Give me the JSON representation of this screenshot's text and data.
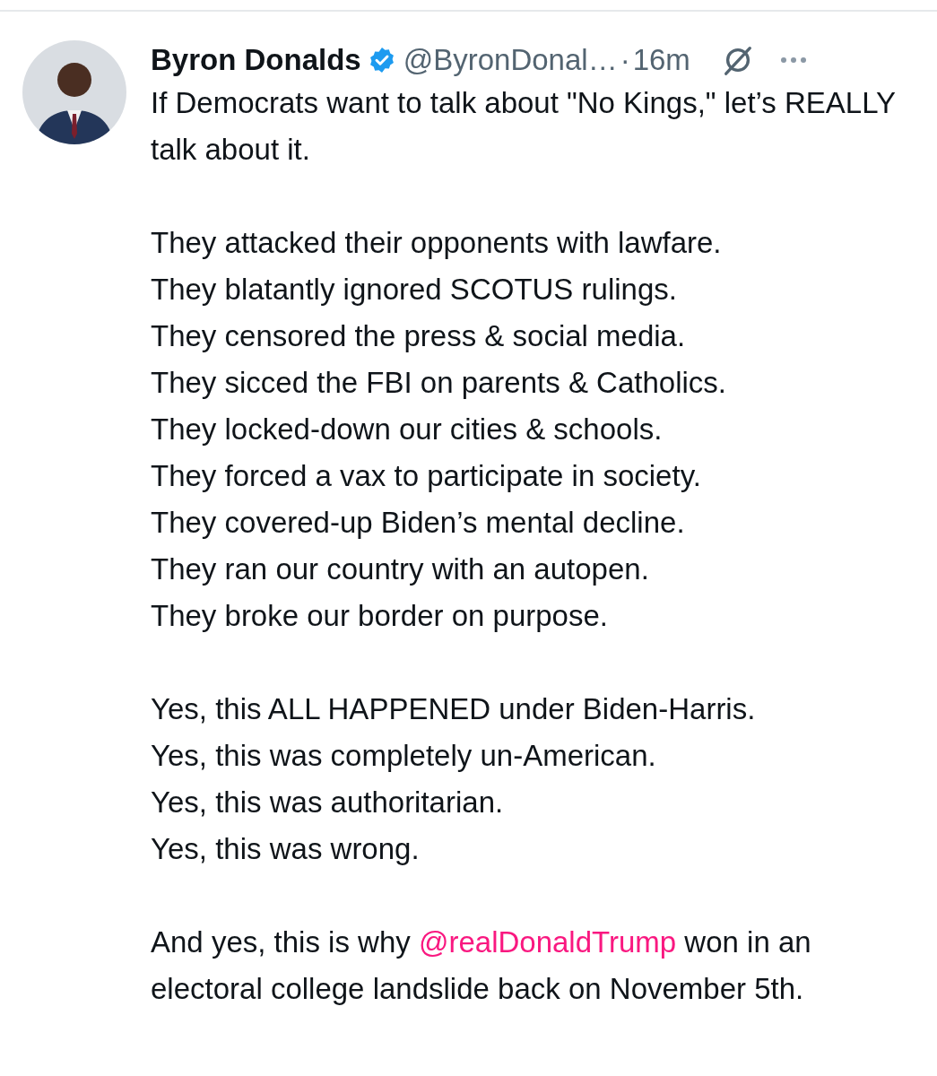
{
  "author": {
    "name": "Byron Donalds",
    "verified": true,
    "handle": "@ByronDonal…",
    "separator": "·",
    "time": "16m"
  },
  "paragraphs": [
    {
      "lines": [
        "If Democrats want to talk about \"No Kings,\" let’s REALLY talk about it."
      ]
    },
    {
      "lines": [
        "They attacked their opponents with lawfare.",
        "They blatantly ignored SCOTUS rulings.",
        "They censored the press & social media.",
        "They sicced the FBI on parents & Catholics.",
        "They locked-down our cities & schools.",
        "They forced a vax to participate in society.",
        "They covered-up Biden’s mental decline.",
        "They ran our country with an autopen.",
        "They broke our border on purpose."
      ]
    },
    {
      "lines": [
        "Yes, this ALL HAPPENED under Biden-Harris.",
        "Yes, this was completely un-American.",
        "Yes, this was authoritarian.",
        "Yes, this was wrong."
      ]
    },
    {
      "segments": [
        {
          "kind": "text",
          "text": "And yes, this is why "
        },
        {
          "kind": "mention",
          "text": "@realDonaldTrump"
        },
        {
          "kind": "text",
          "text": " won in an electoral college landslide back on November 5th."
        }
      ]
    }
  ]
}
